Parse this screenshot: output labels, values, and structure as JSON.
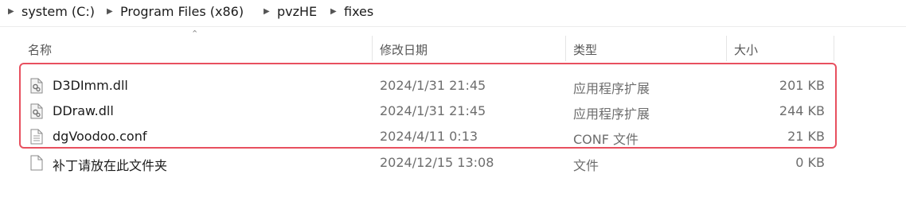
{
  "breadcrumb": [
    "system (C:)",
    "Program Files (x86)",
    "pvzHE",
    "fixes"
  ],
  "columns": {
    "name": "名称",
    "date": "修改日期",
    "type": "类型",
    "size": "大小"
  },
  "files": [
    {
      "name": "D3DImm.dll",
      "date": "2024/1/31 21:45",
      "type": "应用程序扩展",
      "size": "201 KB",
      "icon": "dll-file-icon"
    },
    {
      "name": "DDraw.dll",
      "date": "2024/1/31 21:45",
      "type": "应用程序扩展",
      "size": "244 KB",
      "icon": "dll-file-icon"
    },
    {
      "name": "dgVoodoo.conf",
      "date": "2024/4/11 0:13",
      "type": "CONF 文件",
      "size": "21 KB",
      "icon": "text-file-icon"
    },
    {
      "name": "补丁请放在此文件夹",
      "date": "2024/12/15 13:08",
      "type": "文件",
      "size": "0 KB",
      "icon": "blank-file-icon"
    }
  ],
  "colors": {
    "highlight": "#e8505f",
    "text": "#1b1b1b",
    "muted": "#6d6d6d"
  }
}
